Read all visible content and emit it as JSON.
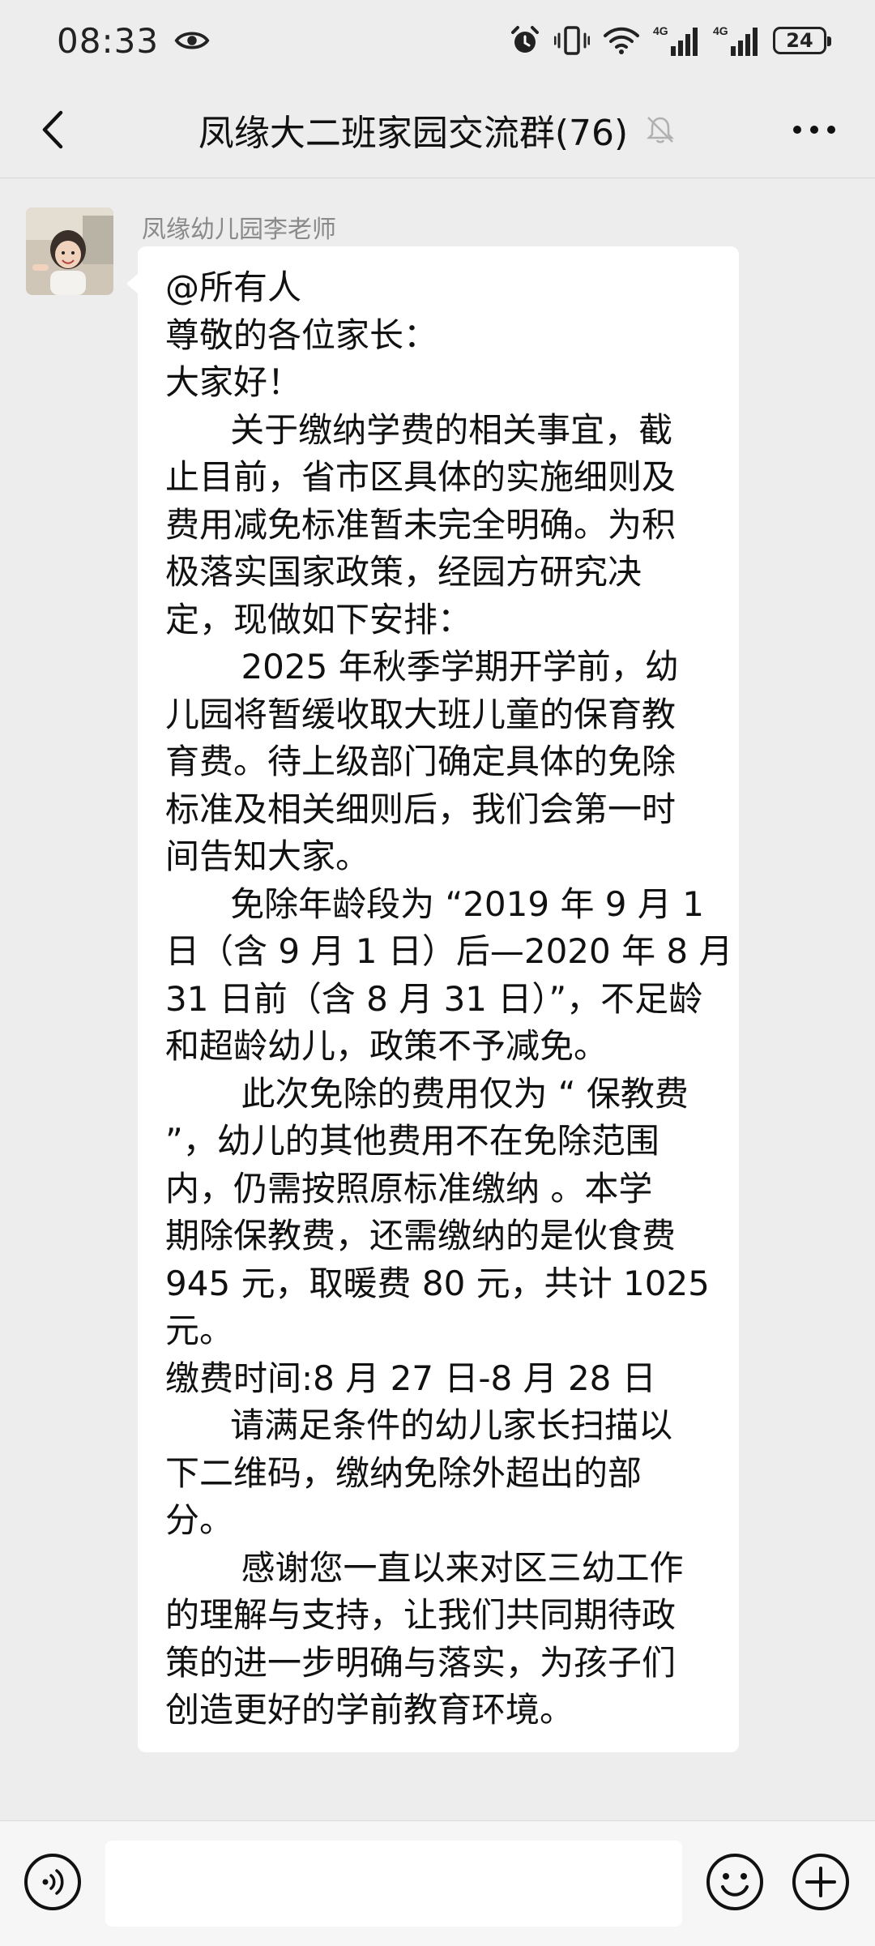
{
  "status_bar": {
    "time": "08:33",
    "network_1": "4G",
    "network_2": "4G",
    "battery": "24"
  },
  "header": {
    "title": "凤缘大二班家园交流群(76)"
  },
  "message": {
    "sender": "凤缘幼儿园李老师",
    "lines": [
      "@所有人",
      "尊敬的各位家长：",
      "大家好！",
      "      关于缴纳学费的相关事宜，截",
      "止目前，省市区具体的实施细则及",
      "费用减免标准暂未完全明确。为积",
      "极落实国家政策，经园方研究决",
      "定，现做如下安排：",
      "       2025 年秋季学期开学前，幼",
      "儿园将暂缓收取大班儿童的保育教",
      "育费。待上级部门确定具体的免除",
      "标准及相关细则后，我们会第一时",
      "间告知大家。",
      "      免除年龄段为 “2019 年 9 月 1",
      "日（含 9 月 1 日）后—2020 年 8 月",
      "31 日前（含 8 月 31 日）”，不足龄",
      "和超龄幼儿，政策不予减免。",
      "       此次免除的费用仅为 “ 保教费",
      "”，幼儿的其他费用不在免除范围",
      "内，仍需按照原标准缴纳 。本学",
      "期除保教费，还需缴纳的是伙食费",
      "945 元，取暖费 80 元，共计 1025",
      "元。",
      "缴费时间:8 月 27 日-8 月 28 日",
      "      请满足条件的幼儿家长扫描以",
      "下二维码，缴纳免除外超出的部",
      "分。",
      "       感谢您一直以来对区三幼工作",
      "的理解与支持，让我们共同期待政",
      "策的进一步明确与落实，为孩子们",
      "创造更好的学前教育环境。"
    ]
  },
  "input_bar": {
    "text": ""
  },
  "icons": {
    "back": "chevron-left-icon",
    "mute": "bell-off-icon",
    "more": "more-icon",
    "voice": "voice-icon",
    "emoji": "smiley-icon",
    "plus": "plus-icon"
  }
}
